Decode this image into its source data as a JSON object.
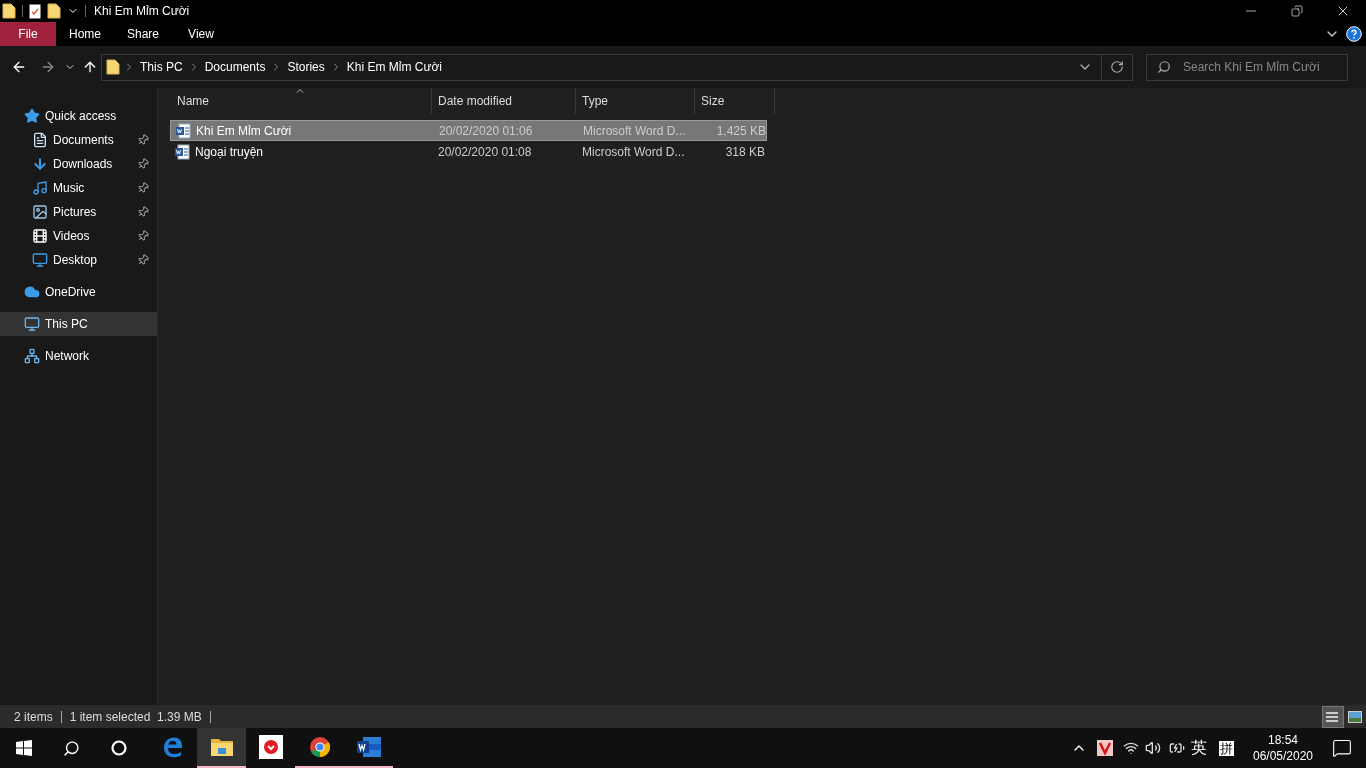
{
  "window": {
    "title": "Khi Em Mỉm Cười"
  },
  "ribbon_tabs": [
    {
      "label": "File",
      "selected": true
    },
    {
      "label": "Home",
      "selected": false
    },
    {
      "label": "Share",
      "selected": false
    },
    {
      "label": "View",
      "selected": false
    }
  ],
  "breadcrumb": [
    "This PC",
    "Documents",
    "Stories",
    "Khi Em Mỉm Cười"
  ],
  "search": {
    "placeholder": "Search Khi Em Mỉm Cười"
  },
  "sidebar": {
    "items": [
      {
        "label": "Quick access",
        "kind": "quick",
        "pinned": false,
        "selected": false,
        "children": [
          {
            "label": "Documents",
            "kind": "documents",
            "pinned": true,
            "selected": false
          },
          {
            "label": "Downloads",
            "kind": "downloads",
            "pinned": true,
            "selected": false
          },
          {
            "label": "Music",
            "kind": "music",
            "pinned": true,
            "selected": false
          },
          {
            "label": "Pictures",
            "kind": "pictures",
            "pinned": true,
            "selected": false
          },
          {
            "label": "Videos",
            "kind": "videos",
            "pinned": true,
            "selected": false
          },
          {
            "label": "Desktop",
            "kind": "desktop",
            "pinned": true,
            "selected": false
          }
        ]
      },
      {
        "label": "OneDrive",
        "kind": "onedrive",
        "pinned": false,
        "selected": false
      },
      {
        "label": "This PC",
        "kind": "pc",
        "pinned": false,
        "selected": true
      },
      {
        "label": "Network",
        "kind": "network",
        "pinned": false,
        "selected": false
      }
    ]
  },
  "table": {
    "columns": [
      "Name",
      "Date modified",
      "Type",
      "Size"
    ],
    "rows": [
      {
        "name": "Khi Em Mỉm Cười",
        "date": "20/02/2020 01:06",
        "type": "Microsoft Word D...",
        "size": "1,425 KB",
        "selected": true
      },
      {
        "name": "Ngoại truyện",
        "date": "20/02/2020 01:08",
        "type": "Microsoft Word D...",
        "size": "318 KB",
        "selected": false
      }
    ]
  },
  "status_bar": {
    "count": "2 items",
    "selection": "1 item selected  1.39 MB"
  },
  "taskbar": {
    "apps": [
      {
        "kind": "edge",
        "running": false,
        "selected": false
      },
      {
        "kind": "explorer",
        "running": true,
        "selected": true
      },
      {
        "kind": "red-app",
        "running": false,
        "selected": false
      },
      {
        "kind": "chrome",
        "running": true,
        "selected": false
      },
      {
        "kind": "word",
        "running": true,
        "selected": false
      }
    ],
    "input_mode": "英",
    "ime": "拼",
    "time": "18:54",
    "date": "06/05/2020"
  }
}
